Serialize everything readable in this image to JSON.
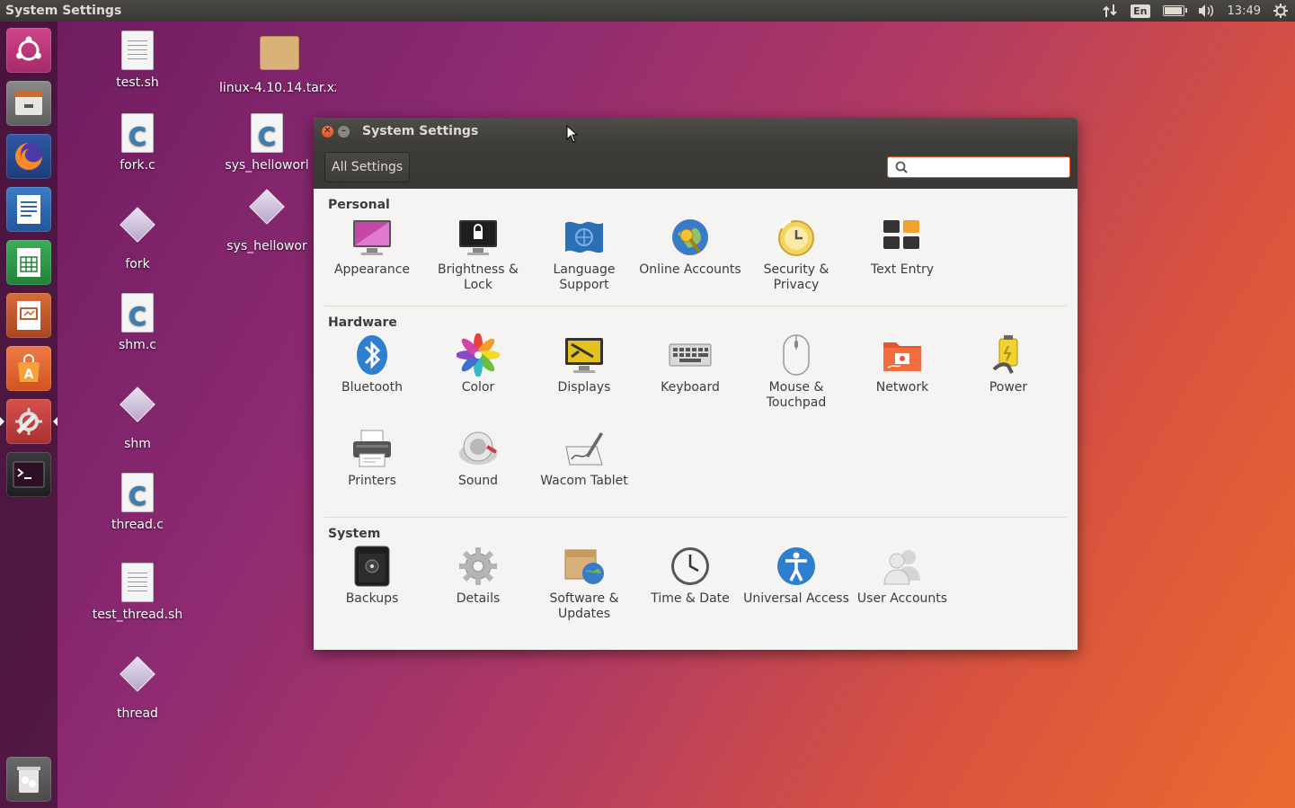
{
  "topbar": {
    "app_title": "System Settings",
    "language": "En",
    "time": "13:49",
    "battery_level": 0.9
  },
  "launcher": {
    "items": [
      {
        "name": "ubuntu-dash",
        "color": "#c3377d"
      },
      {
        "name": "files",
        "color": "#6b6b6b"
      },
      {
        "name": "firefox",
        "color": "#2a4b8f"
      },
      {
        "name": "writer",
        "color": "#2f67b1"
      },
      {
        "name": "calc",
        "color": "#2e9a49"
      },
      {
        "name": "impress",
        "color": "#c8582c"
      },
      {
        "name": "software-center",
        "color": "#e2693a"
      },
      {
        "name": "system-settings",
        "color": "#c9403d"
      },
      {
        "name": "terminal",
        "color": "#2c2c2c"
      },
      {
        "name": "trash",
        "color": "#5a5a5a"
      }
    ]
  },
  "desktop": {
    "icons": [
      {
        "label": "test.sh",
        "kind": "doc"
      },
      {
        "label": "fork.c",
        "kind": "c"
      },
      {
        "label": "fork",
        "kind": "exe"
      },
      {
        "label": "shm.c",
        "kind": "c"
      },
      {
        "label": "shm",
        "kind": "exe"
      },
      {
        "label": "thread.c",
        "kind": "c"
      },
      {
        "label": "test_thread.sh",
        "kind": "doc"
      },
      {
        "label": "thread",
        "kind": "exe"
      },
      {
        "label": "linux-4.10.14.tar.xz",
        "kind": "pkg"
      },
      {
        "label": "sys_helloworl",
        "kind": "c"
      },
      {
        "label": "sys_hellowor",
        "kind": "exe"
      }
    ]
  },
  "window": {
    "title": "System Settings",
    "all_settings_label": "All Settings",
    "search_placeholder": "",
    "sections": [
      {
        "title": "Personal",
        "items": [
          {
            "label": "Appearance",
            "icon": "appearance-icon"
          },
          {
            "label": "Brightness & Lock",
            "icon": "brightness-lock-icon"
          },
          {
            "label": "Language Support",
            "icon": "language-support-icon"
          },
          {
            "label": "Online Accounts",
            "icon": "online-accounts-icon"
          },
          {
            "label": "Security & Privacy",
            "icon": "security-privacy-icon"
          },
          {
            "label": "Text Entry",
            "icon": "text-entry-icon"
          }
        ]
      },
      {
        "title": "Hardware",
        "items": [
          {
            "label": "Bluetooth",
            "icon": "bluetooth-icon"
          },
          {
            "label": "Color",
            "icon": "color-icon"
          },
          {
            "label": "Displays",
            "icon": "displays-icon"
          },
          {
            "label": "Keyboard",
            "icon": "keyboard-icon"
          },
          {
            "label": "Mouse & Touchpad",
            "icon": "mouse-touchpad-icon"
          },
          {
            "label": "Network",
            "icon": "network-icon"
          },
          {
            "label": "Power",
            "icon": "power-icon"
          },
          {
            "label": "Printers",
            "icon": "printers-icon"
          },
          {
            "label": "Sound",
            "icon": "sound-icon"
          },
          {
            "label": "Wacom Tablet",
            "icon": "wacom-tablet-icon"
          }
        ]
      },
      {
        "title": "System",
        "items": [
          {
            "label": "Backups",
            "icon": "backups-icon"
          },
          {
            "label": "Details",
            "icon": "details-icon"
          },
          {
            "label": "Software & Updates",
            "icon": "software-updates-icon"
          },
          {
            "label": "Time & Date",
            "icon": "time-date-icon"
          },
          {
            "label": "Universal Access",
            "icon": "universal-access-icon"
          },
          {
            "label": "User Accounts",
            "icon": "user-accounts-icon"
          }
        ]
      }
    ]
  }
}
